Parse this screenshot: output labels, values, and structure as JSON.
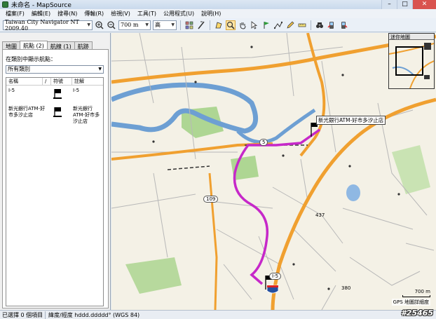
{
  "window": {
    "title": "未命名 - MapSource",
    "minimize": "–",
    "maximize": "□",
    "close": "✕"
  },
  "menu": [
    "檔案(F)",
    "編輯(E)",
    "搜尋(N)",
    "傳輸(R)",
    "檢視(V)",
    "工具(T)",
    "公用程式(U)",
    "說明(H)"
  ],
  "toolbar": {
    "map_product": "Taiwan City Navigator NT 2009.40",
    "zoom": "700 m",
    "detail": "高"
  },
  "left_panel": {
    "tabs": [
      "地圖",
      "航點 (2)",
      "航線 (1)",
      "航跡"
    ],
    "active_tab": 1,
    "filter_label": "在類別中顯示航點：",
    "filter_value": "所有類別",
    "columns": [
      "名稱",
      "/",
      "符號",
      "註解"
    ],
    "rows": [
      {
        "name": "I-5",
        "note": "I-5"
      },
      {
        "name": "新光銀行ATM-好市多汐止店",
        "note": "新光銀行ATM-好市多汐止店"
      }
    ]
  },
  "map": {
    "overview_title": "迷你地圖",
    "scale_label": "700 m",
    "precision_label": "GPS 地圖詳細度",
    "poi_label": "新光銀行ATM-好市多汐止店",
    "route_badge_109": "109",
    "route_badge_5": "5",
    "route_badge_i5": "I-5",
    "elevation_437": "437",
    "elevation_380": "380"
  },
  "status": {
    "selected": "已選擇 0 個項目",
    "coords": "緯度/經度 hddd.ddddd° (WGS 84)"
  },
  "watermark": "#25465",
  "colors": {
    "route": "#c628c9",
    "highway": "#f0a030",
    "river": "#6d9fd3",
    "park": "#9ccf7e"
  }
}
